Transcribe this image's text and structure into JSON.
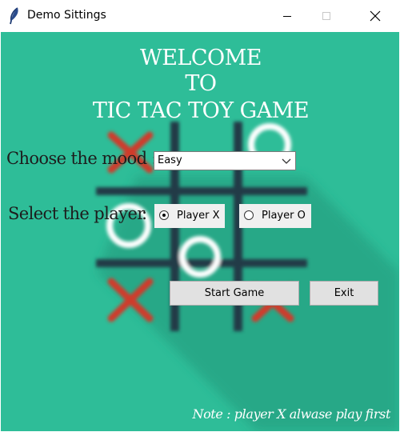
{
  "window": {
    "title": "Demo Sittings"
  },
  "header": {
    "line1": "WELCOME",
    "line2": "TO",
    "line3": "TIC TAC TOY GAME"
  },
  "mode": {
    "label": "Choose the mood :",
    "value": "Easy"
  },
  "player": {
    "label": "Select the player",
    "colon": ":",
    "options": [
      {
        "label": "Player X",
        "selected": true
      },
      {
        "label": "Player O",
        "selected": false
      }
    ]
  },
  "actions": {
    "start_label": "Start Game",
    "exit_label": "Exit"
  },
  "note": "Note : player X alwase play first",
  "colors": {
    "background": "#2ebd98",
    "board_lines": "#203a47",
    "x_marks": "#d03a2c",
    "o_marks": "#ffffff"
  }
}
